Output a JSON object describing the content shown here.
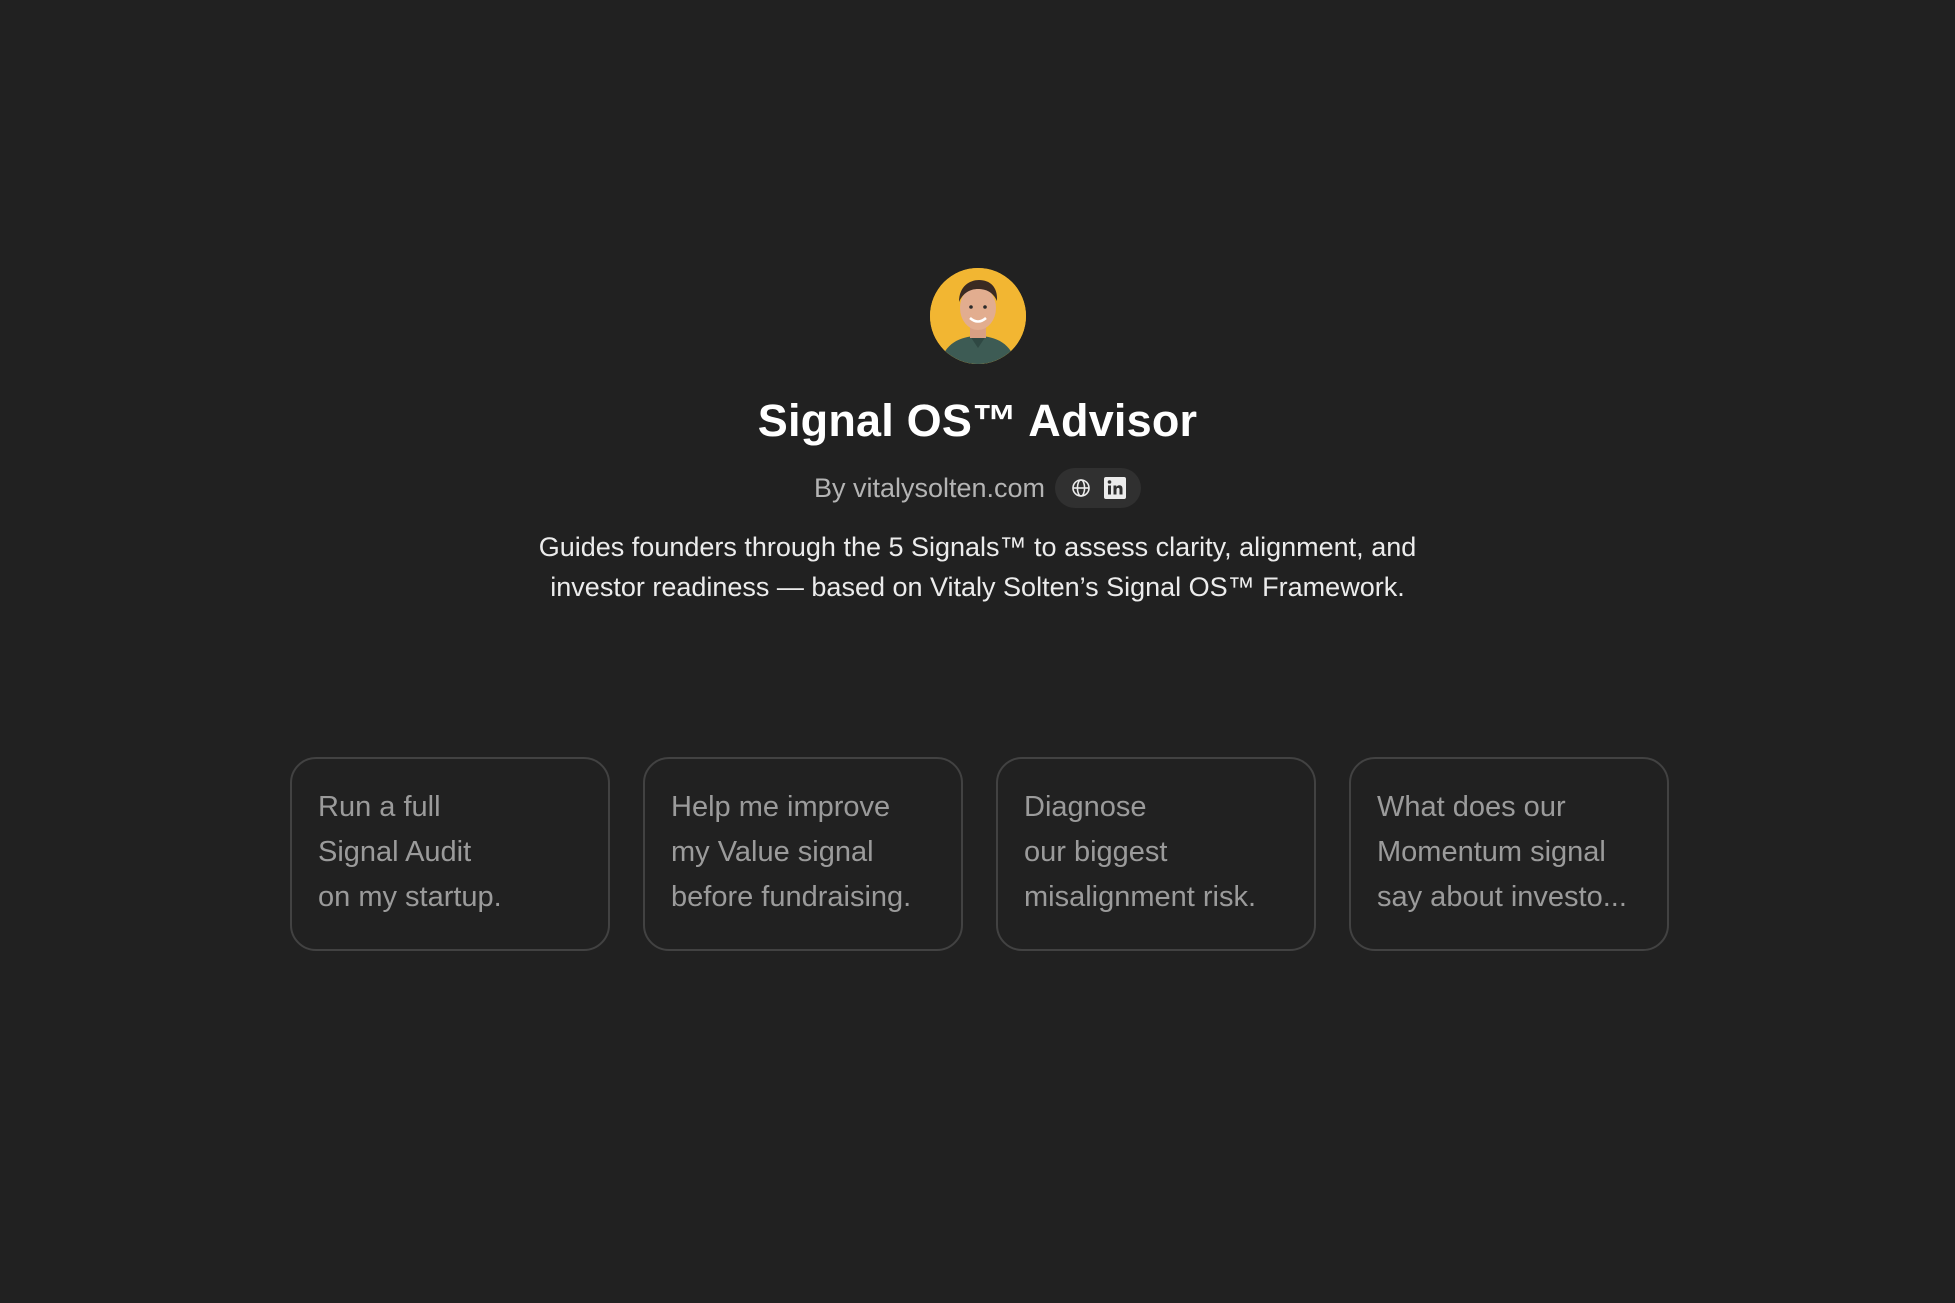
{
  "gpt": {
    "title": "Signal OS™ Advisor",
    "byline": "By vitalysolten.com",
    "description": "Guides founders through the 5 Signals™ to assess clarity, alignment, and investor readiness — based on Vitaly Solten’s Signal OS™ Framework.",
    "avatar_bg": "#f2b632",
    "social_icons": [
      "globe-icon",
      "linkedin-icon"
    ]
  },
  "starters": [
    {
      "lines": [
        "Run a full",
        "Signal Audit",
        "on my startup."
      ]
    },
    {
      "lines": [
        "Help me improve",
        "my Value signal",
        "before fundraising."
      ]
    },
    {
      "lines": [
        "Diagnose",
        "our biggest",
        "misalignment risk."
      ]
    },
    {
      "lines": [
        "What does our",
        "Momentum signal",
        "say about investo..."
      ]
    }
  ],
  "colors": {
    "background": "#212121",
    "card_border": "#424242",
    "muted_text": "#9b9b9b"
  }
}
